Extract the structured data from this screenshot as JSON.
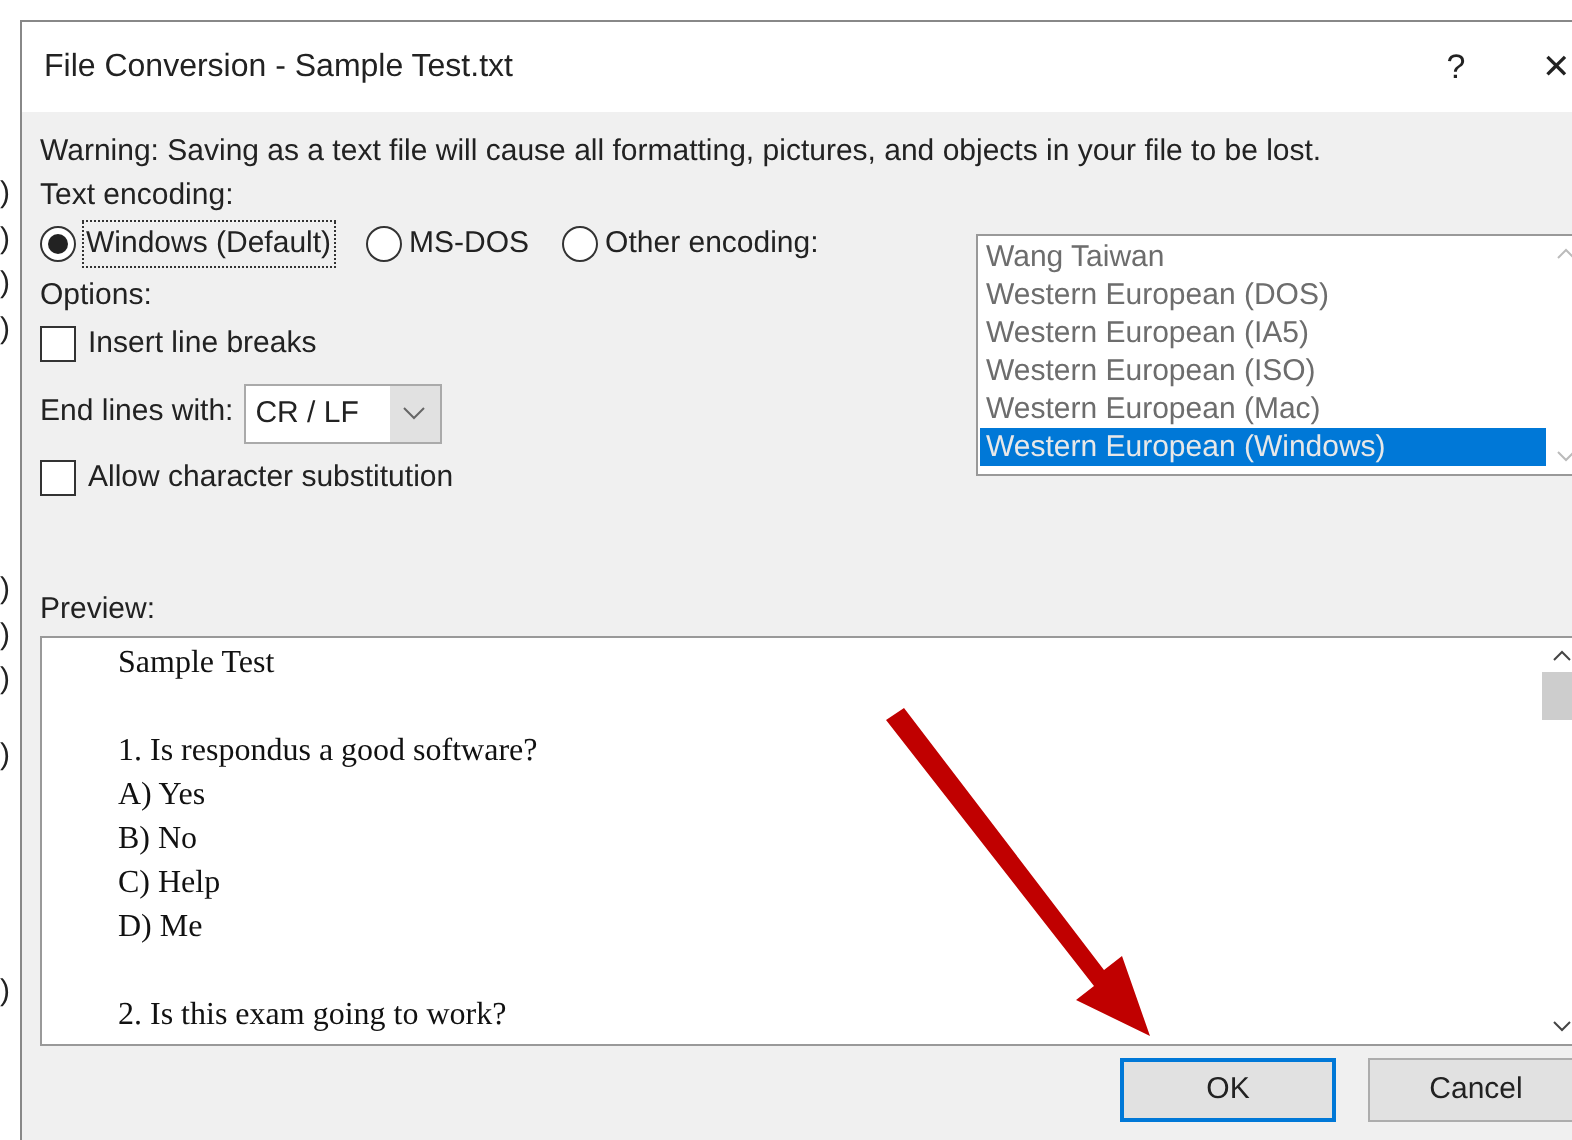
{
  "background_document": {
    "fragments": [
      ")",
      ")",
      ")",
      ")",
      ")",
      ")",
      ")",
      ")",
      ")"
    ]
  },
  "window": {
    "title": "File Conversion - Sample Test.txt",
    "help": "?",
    "close": "✕"
  },
  "warning": "Warning: Saving as a text file will cause all formatting, pictures, and objects in your file to be lost.",
  "text_encoding": {
    "label": "Text encoding:",
    "options": [
      {
        "label": "Windows (Default)",
        "selected": true
      },
      {
        "label": "MS-DOS",
        "selected": false
      },
      {
        "label": "Other encoding:",
        "selected": false
      }
    ]
  },
  "encoding_list": {
    "disabled": true,
    "items": [
      {
        "label": "Wang Taiwan",
        "selected": false
      },
      {
        "label": "Western European (DOS)",
        "selected": false
      },
      {
        "label": "Western European (IA5)",
        "selected": false
      },
      {
        "label": "Western European (ISO)",
        "selected": false
      },
      {
        "label": "Western European (Mac)",
        "selected": false
      },
      {
        "label": "Western European (Windows)",
        "selected": true
      }
    ]
  },
  "options_label": "Options:",
  "insert_line_breaks": {
    "label": "Insert line breaks",
    "checked": false
  },
  "end_lines": {
    "label": "End lines with:",
    "value": "CR / LF"
  },
  "allow_substitution": {
    "label": "Allow character substitution",
    "checked": false
  },
  "preview": {
    "label": "Preview:",
    "paragraphs": [
      [
        "Sample Test"
      ],
      [
        "1. Is respondus a good software?",
        "A) Yes",
        "B) No",
        "C) Help",
        "D) Me"
      ],
      [
        "2. Is this exam going to work?"
      ]
    ]
  },
  "buttons": [
    {
      "label": "OK",
      "default": true
    },
    {
      "label": "Cancel",
      "default": false
    }
  ]
}
